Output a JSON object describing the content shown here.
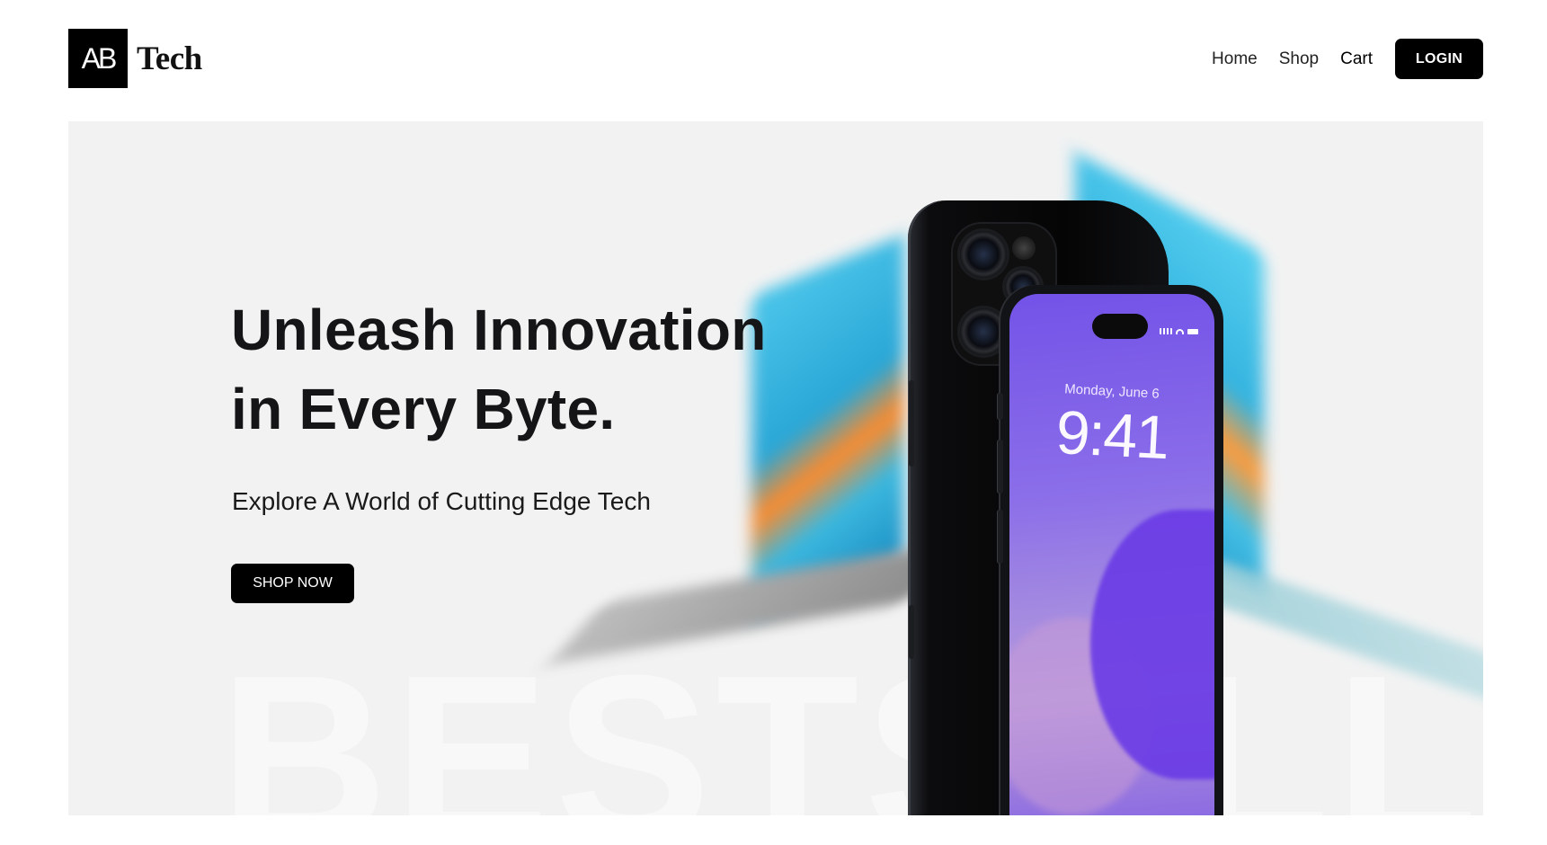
{
  "brand": {
    "mark": "AB",
    "name": "Tech"
  },
  "nav": {
    "links": [
      "Home",
      "Shop",
      "Cart"
    ],
    "login_label": "LOGIN"
  },
  "hero": {
    "headline_line1": "Unleash Innovation",
    "headline_line2": "in Every Byte.",
    "subheading": "Explore A World of Cutting Edge Tech",
    "cta_label": "SHOP NOW",
    "background_text": "BESTSELLE",
    "phone_lock_date": "Monday, June 6",
    "phone_lock_time": "9:41"
  },
  "colors": {
    "hero_background": "#f2f2f2",
    "button_background": "#000000",
    "button_text": "#ffffff",
    "screen_accent": "#7353e8"
  }
}
